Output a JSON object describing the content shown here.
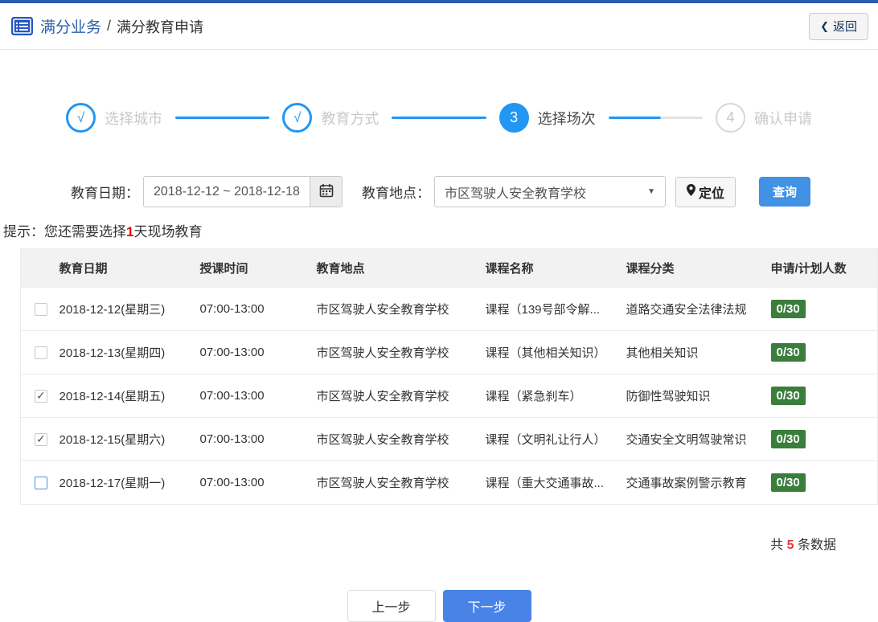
{
  "header": {
    "title_primary": "满分业务",
    "separator": "/",
    "title_secondary": "满分教育申请",
    "back_label": "返回",
    "back_chevron": "❮"
  },
  "stepper": {
    "steps": [
      {
        "mark": "√",
        "label": "选择城市",
        "state": "done"
      },
      {
        "mark": "√",
        "label": "教育方式",
        "state": "done"
      },
      {
        "mark": "3",
        "label": "选择场次",
        "state": "active"
      },
      {
        "mark": "4",
        "label": "确认申请",
        "state": "pending"
      }
    ]
  },
  "filters": {
    "date_label": "教育日期：",
    "date_value": "2018-12-12 ~ 2018-12-18",
    "location_label": "教育地点：",
    "location_value": "市区驾驶人安全教育学校",
    "caret_glyph": "▼",
    "locate_label": "定位",
    "search_label": "查询"
  },
  "hint": {
    "prefix": "提示：您还需要选择",
    "highlight": "1",
    "suffix": "天现场教育"
  },
  "table": {
    "headers": [
      "",
      "教育日期",
      "授课时间",
      "教育地点",
      "课程名称",
      "课程分类",
      "申请/计划人数"
    ],
    "rows": [
      {
        "checked": false,
        "focused": false,
        "date": "2018-12-12(星期三)",
        "time": "07:00-13:00",
        "place": "市区驾驶人安全教育学校",
        "course": "课程（139号部令解...",
        "category": "道路交通安全法律法规",
        "quota": "0/30"
      },
      {
        "checked": false,
        "focused": false,
        "date": "2018-12-13(星期四)",
        "time": "07:00-13:00",
        "place": "市区驾驶人安全教育学校",
        "course": "课程（其他相关知识）",
        "category": "其他相关知识",
        "quota": "0/30"
      },
      {
        "checked": true,
        "focused": false,
        "date": "2018-12-14(星期五)",
        "time": "07:00-13:00",
        "place": "市区驾驶人安全教育学校",
        "course": "课程（紧急刹车）",
        "category": "防御性驾驶知识",
        "quota": "0/30"
      },
      {
        "checked": true,
        "focused": false,
        "date": "2018-12-15(星期六)",
        "time": "07:00-13:00",
        "place": "市区驾驶人安全教育学校",
        "course": "课程（文明礼让行人）",
        "category": "交通安全文明驾驶常识",
        "quota": "0/30"
      },
      {
        "checked": false,
        "focused": true,
        "date": "2018-12-17(星期一)",
        "time": "07:00-13:00",
        "place": "市区驾驶人安全教育学校",
        "course": "课程（重大交通事故...",
        "category": "交通事故案例警示教育",
        "quota": "0/30"
      }
    ]
  },
  "footer": {
    "total_prefix": "共",
    "total_count": "5",
    "total_suffix": "条数据",
    "prev_label": "上一步",
    "next_label": "下一步"
  },
  "icons": [
    "list-icon",
    "chevron-left-icon",
    "calendar-icon",
    "caret-down-icon",
    "location-pin-icon",
    "check-icon"
  ],
  "colors": {
    "brand_blue": "#2b5fac",
    "stepper_blue": "#2196f3",
    "search_button_blue": "#4191e5",
    "next_button_blue": "#4a83e8",
    "badge_green": "#3a7d3c",
    "hint_red": "#f00000",
    "count_red": "#e4393c",
    "header_bg": "#f2f2f2"
  }
}
